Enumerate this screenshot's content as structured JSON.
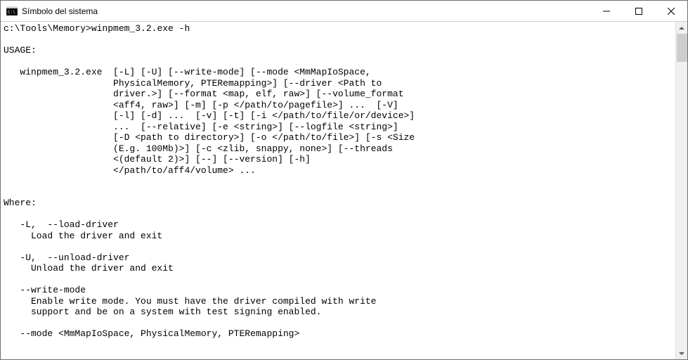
{
  "window": {
    "title": "Símbolo del sistema"
  },
  "terminal": {
    "prompt": "c:\\Tools\\Memory>",
    "command": "winpmem_3.2.exe -h",
    "output": {
      "blank1": "",
      "usage_header": "USAGE:",
      "blank2": "",
      "usage_line1": "   winpmem_3.2.exe  [-L] [-U] [--write-mode] [--mode <MmMapIoSpace,",
      "usage_line2": "                    PhysicalMemory, PTERemapping>] [--driver <Path to",
      "usage_line3": "                    driver.>] [--format <map, elf, raw>] [--volume_format",
      "usage_line4": "                    <aff4, raw>] [-m] [-p </path/to/pagefile>] ...  [-V]",
      "usage_line5": "                    [-l] [-d] ...  [-v] [-t] [-i </path/to/file/or/device>]",
      "usage_line6": "                    ...  [--relative] [-e <string>] [--logfile <string>]",
      "usage_line7": "                    [-D <path to directory>] [-o </path/to/file>] [-s <Size",
      "usage_line8": "                    (E.g. 100Mb)>] [-c <zlib, snappy, none>] [--threads",
      "usage_line9": "                    <(default 2)>] [--] [--version] [-h]",
      "usage_line10": "                    </path/to/aff4/volume> ...",
      "blank3": "",
      "blank4": "",
      "where_header": "Where:",
      "blank5": "",
      "opt_L": "   -L,  --load-driver",
      "opt_L_desc": "     Load the driver and exit",
      "blank6": "",
      "opt_U": "   -U,  --unload-driver",
      "opt_U_desc": "     Unload the driver and exit",
      "blank7": "",
      "opt_write": "   --write-mode",
      "opt_write_desc1": "     Enable write mode. You must have the driver compiled with write",
      "opt_write_desc2": "     support and be on a system with test signing enabled.",
      "blank8": "",
      "opt_mode": "   --mode <MmMapIoSpace, PhysicalMemory, PTERemapping>"
    }
  }
}
